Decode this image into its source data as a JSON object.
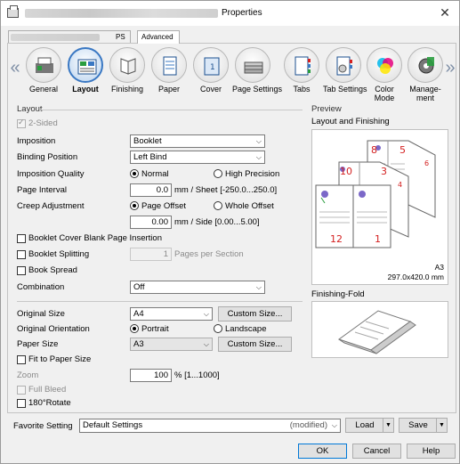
{
  "window": {
    "title": "Properties",
    "close_glyph": "✕"
  },
  "top_tabs": [
    {
      "label": "PS"
    },
    {
      "label": "Advanced"
    }
  ],
  "toolbar": {
    "items": [
      {
        "label": "General",
        "icon": "general-icon"
      },
      {
        "label": "Layout",
        "icon": "layout-icon",
        "selected": true
      },
      {
        "label": "Finishing",
        "icon": "finishing-icon"
      },
      {
        "label": "Paper",
        "icon": "paper-icon"
      },
      {
        "label": "Cover",
        "icon": "cover-icon"
      },
      {
        "label": "Page Settings",
        "icon": "page-settings-icon"
      },
      {
        "label": "Tabs",
        "icon": "tabs-icon"
      },
      {
        "label": "Tab Settings",
        "icon": "tab-settings-icon"
      },
      {
        "label": "Color Mode",
        "label_line1": "Color",
        "label_line2": "Mode",
        "icon": "color-mode-icon"
      },
      {
        "label": "Management",
        "label_line1": "Manage-",
        "label_line2": "ment",
        "icon": "management-icon"
      }
    ],
    "left_arrow": "«",
    "right_arrow": "»"
  },
  "layout": {
    "section_title": "Layout",
    "two_sided": {
      "label": "2-Sided",
      "checked": true,
      "disabled": true
    },
    "imposition": {
      "label": "Imposition",
      "value": "Booklet"
    },
    "binding_position": {
      "label": "Binding Position",
      "value": "Left Bind"
    },
    "imposition_quality": {
      "label": "Imposition Quality",
      "options": [
        "Normal",
        "High Precision"
      ],
      "selected": "Normal"
    },
    "page_interval": {
      "label": "Page Interval",
      "value": "0.0",
      "unit": "mm / Sheet [-250.0...250.0]"
    },
    "creep_adjustment": {
      "label": "Creep Adjustment",
      "options": [
        "Page Offset",
        "Whole Offset"
      ],
      "selected": "Page Offset",
      "value": "0.00",
      "unit": "mm / Side [0.00...5.00]"
    },
    "booklet_cover_blank": {
      "label": "Booklet Cover Blank Page Insertion",
      "checked": false
    },
    "booklet_splitting": {
      "label": "Booklet Splitting",
      "checked": false,
      "value": "1",
      "unit": "Pages per Section"
    },
    "book_spread": {
      "label": "Book Spread",
      "checked": false
    },
    "combination": {
      "label": "Combination",
      "value": "Off"
    }
  },
  "paper": {
    "original_size": {
      "label": "Original Size",
      "value": "A4",
      "button": "Custom Size..."
    },
    "original_orientation": {
      "label": "Original Orientation",
      "options": [
        "Portrait",
        "Landscape"
      ],
      "selected": "Portrait"
    },
    "paper_size": {
      "label": "Paper Size",
      "value": "A3",
      "button": "Custom Size..."
    },
    "fit_to_paper": {
      "label": "Fit to Paper Size",
      "checked": false
    },
    "zoom": {
      "label": "Zoom",
      "value": "100",
      "unit": "% [1...1000]"
    },
    "full_bleed": {
      "label": "Full Bleed",
      "checked": false,
      "disabled": true
    },
    "rotate_180": {
      "label": "180°Rotate",
      "checked": false
    }
  },
  "preview": {
    "title": "Preview",
    "layout_finishing_label": "Layout and Finishing",
    "page_numbers": [
      "8",
      "5",
      "6",
      "10",
      "3",
      "4",
      "12",
      "1"
    ],
    "paper_name": "A3",
    "paper_dims": "297.0x420.0 mm",
    "finishing_fold_label": "Finishing-Fold"
  },
  "favorite": {
    "label": "Favorite Setting",
    "value": "Default Settings",
    "status": "(modified)",
    "load": "Load",
    "save": "Save"
  },
  "footer": {
    "ok": "OK",
    "cancel": "Cancel",
    "help": "Help"
  },
  "colors": {
    "accent": "#0078d7",
    "selected_icon_border": "#3a78c3",
    "page_number_red": "#d42020"
  }
}
